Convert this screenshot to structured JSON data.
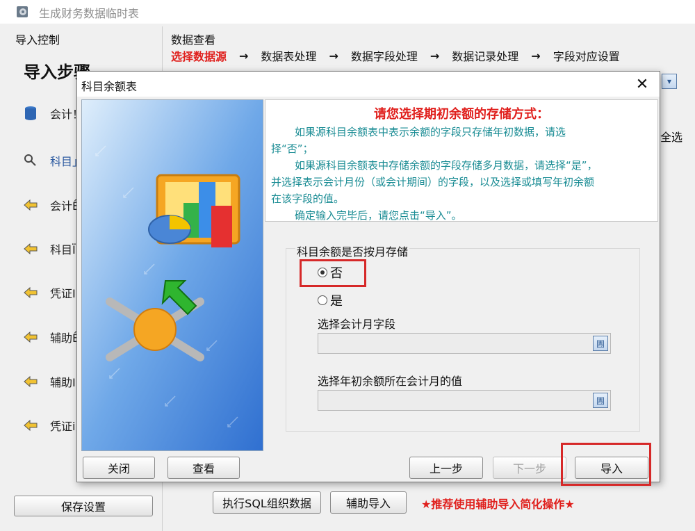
{
  "app": {
    "title": "生成财务数据临时表",
    "icon": "app-gear-icon"
  },
  "left_panel": {
    "header": "导入控制",
    "steps_title": "导入步骤.",
    "items": [
      {
        "label": "会计！",
        "icon": "database-icon"
      },
      {
        "label": "科目」",
        "icon": "search-icon"
      },
      {
        "label": "会计Ê",
        "icon": "arrow-left-icon"
      },
      {
        "label": "科目Ï",
        "icon": "arrow-left-icon"
      },
      {
        "label": "凭证I",
        "icon": "arrow-left-icon"
      },
      {
        "label": "辅助Ê",
        "icon": "arrow-left-icon"
      },
      {
        "label": "辅助I",
        "icon": "arrow-left-icon"
      },
      {
        "label": "凭证i",
        "icon": "arrow-left-icon"
      }
    ],
    "save_button": "保存设置"
  },
  "main": {
    "header": "数据查看",
    "wizard_steps": [
      "选择数据源",
      "数据表处理",
      "数据字段处理",
      "数据记录处理",
      "字段对应设置"
    ],
    "arrow": "→",
    "select_all": "全选",
    "exec_sql_button": "执行SQL组织数据",
    "assist_import_button": "辅助导入",
    "hint": "★推荐使用辅助导入简化操作★"
  },
  "dialog": {
    "title": "科目余额表",
    "close": "✕",
    "info": {
      "heading": "请您选择期初余额的存储方式：",
      "lines": [
        "如果源科目余额表中表示余额的字段只存储年初数据，请选",
        "择“否”；",
        "如果源科目余额表中存储余额的字段存储多月数据，请选择“是”，",
        "并选择表示会计月份（或会计期间）的字段，以及选择或填写年初余额",
        "在该字段的值。",
        "确定输入完毕后，请您点击“导入”。"
      ]
    },
    "group_label": "科目余额是否按月存储",
    "option_no": "否",
    "option_yes": "是",
    "selected": "否",
    "month_field_label": "选择会计月字段",
    "month_field_value": "",
    "init_value_label": "选择年初余额所在会计月的值",
    "init_value_value": "",
    "buttons": {
      "close": "关闭",
      "view": "查看",
      "prev": "上一步",
      "next": "下一步",
      "import": "导入"
    }
  }
}
